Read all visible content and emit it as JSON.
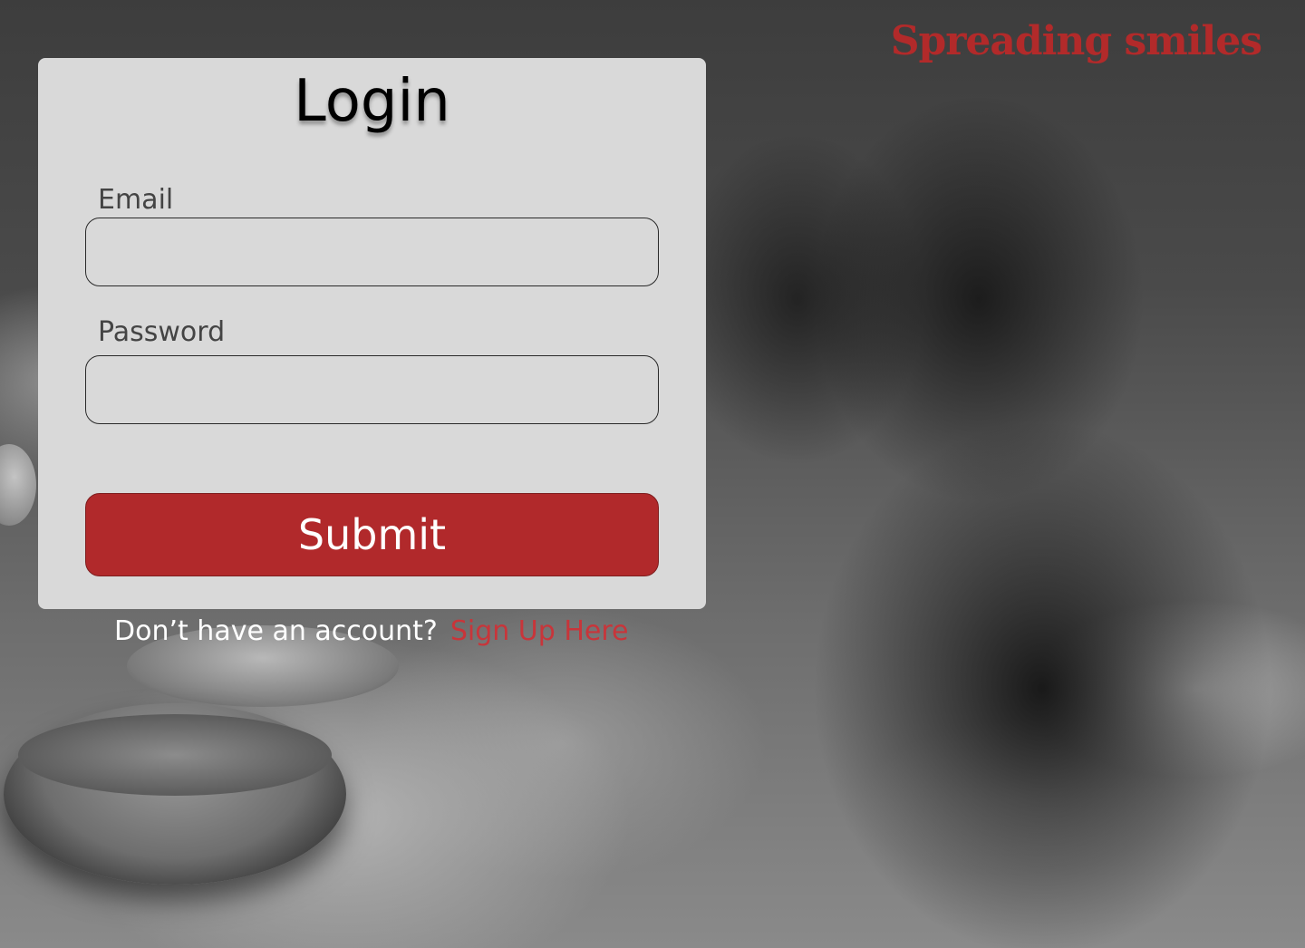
{
  "brand": {
    "name": "Spreading smiles",
    "color": "#b22a2a"
  },
  "login_form": {
    "title": "Login",
    "email": {
      "label": "Email",
      "value": "",
      "placeholder": ""
    },
    "password": {
      "label": "Password",
      "value": "",
      "placeholder": ""
    },
    "submit_label": "Submit",
    "submit_color": "#b1292b"
  },
  "signup": {
    "prompt": "Don’t have an account?",
    "link_label": "Sign Up Here",
    "link_color": "#c8353a"
  },
  "background": {
    "description_icon": "photo-background"
  }
}
